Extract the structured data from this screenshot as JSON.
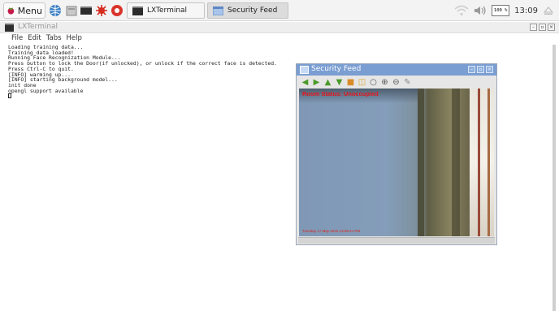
{
  "taskbar": {
    "menu_label": "Menu",
    "icons": [
      "raspberry-icon",
      "web-browser-icon",
      "file-manager-icon",
      "terminal-icon",
      "math-icon",
      "help-icon"
    ],
    "tasks": [
      {
        "label": "LXTerminal",
        "icon": "terminal-icon",
        "active": false
      },
      {
        "label": "Security Feed",
        "icon": "window-icon",
        "active": true
      }
    ],
    "tray": {
      "cpu_label": "100 %",
      "clock": "13:09"
    }
  },
  "terminal": {
    "title": "LXTerminal",
    "menu": [
      "File",
      "Edit",
      "Tabs",
      "Help"
    ],
    "lines": [
      "Loading training data...",
      "Training data loaded!",
      "Running Face Recognization Module...",
      "Press button to lock the Door(if unlocked), or unlock if the correct face is detected.",
      "Press Ctrl-C to quit.",
      "[INFO] warming up...",
      "[INFO] starting background model...",
      "init done",
      "opengl support available"
    ]
  },
  "feed": {
    "title": "Security Feed",
    "toolbar": [
      "arrow-left-icon",
      "arrow-right-icon",
      "arrow-up-icon",
      "arrow-down-icon",
      "save-icon",
      "properties-icon",
      "zoom-icon",
      "zoom-in-icon",
      "zoom-out-icon",
      "pin-icon"
    ],
    "room_status": "Room Status: Unoccupied",
    "timestamp": "Tuesday 17 May 2016 13:09:41 PM"
  },
  "colors": {
    "overlay_red": "#e3141b",
    "titlebar_blue": "#7a9ed2"
  }
}
